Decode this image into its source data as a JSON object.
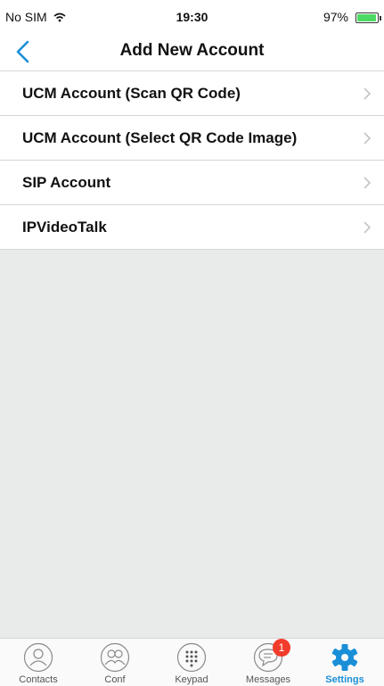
{
  "status_bar": {
    "carrier": "No SIM",
    "time": "19:30",
    "battery": "97%"
  },
  "nav": {
    "title": "Add New Account"
  },
  "accounts": [
    {
      "label": "UCM Account (Scan QR Code)"
    },
    {
      "label": "UCM Account (Select QR Code Image)"
    },
    {
      "label": "SIP Account"
    },
    {
      "label": "IPVideoTalk"
    }
  ],
  "tabs": [
    {
      "label": "Contacts",
      "icon": "contacts-icon"
    },
    {
      "label": "Conf",
      "icon": "conference-icon"
    },
    {
      "label": "Keypad",
      "icon": "keypad-icon"
    },
    {
      "label": "Messages",
      "icon": "messages-icon",
      "badge": "1"
    },
    {
      "label": "Settings",
      "icon": "settings-gear-icon",
      "active": true
    }
  ],
  "colors": {
    "accent": "#1a8fd8",
    "badge": "#f23b2a",
    "background": "#e8ebea"
  }
}
